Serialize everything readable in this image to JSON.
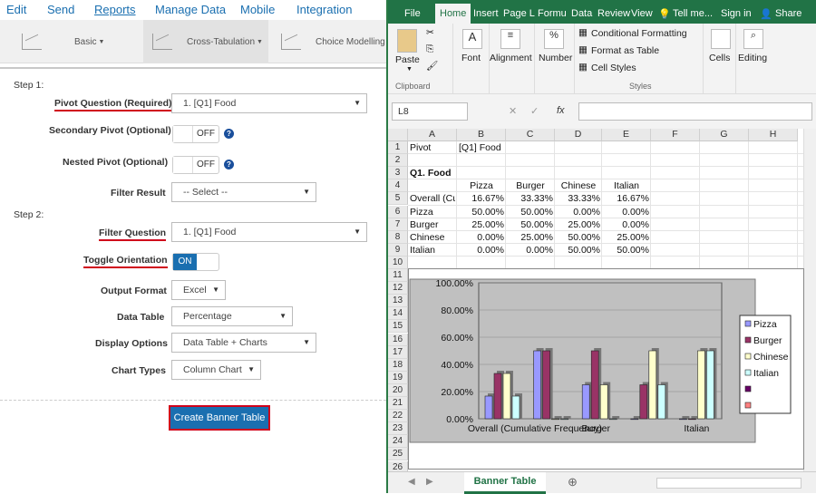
{
  "left": {
    "nav": [
      "Edit",
      "Send",
      "Reports",
      "Manage Data",
      "Mobile",
      "Integration"
    ],
    "active_nav": "Reports",
    "toolbar": [
      "Basic",
      "Cross-Tabulation",
      "Choice Modelling"
    ],
    "step1": "Step 1:",
    "step2": "Step 2:",
    "fields": {
      "pivot_question": {
        "label": "Pivot Question (Required)",
        "value": "1. [Q1] Food"
      },
      "secondary_pivot": {
        "label": "Secondary Pivot (Optional)",
        "value": "OFF"
      },
      "nested_pivot": {
        "label": "Nested Pivot (Optional)",
        "value": "OFF"
      },
      "filter_result": {
        "label": "Filter Result",
        "value": "-- Select --"
      },
      "filter_question": {
        "label": "Filter Question",
        "value": "1. [Q1] Food"
      },
      "toggle_orientation": {
        "label": "Toggle Orientation",
        "value": "ON"
      },
      "output_format": {
        "label": "Output Format",
        "value": "Excel"
      },
      "data_table": {
        "label": "Data Table",
        "value": "Percentage"
      },
      "display_options": {
        "label": "Display Options",
        "value": "Data Table + Charts"
      },
      "chart_types": {
        "label": "Chart Types",
        "value": "Column Chart"
      }
    },
    "create_button": "Create Banner Table"
  },
  "excel": {
    "tabs": [
      "File",
      "Home",
      "Insert",
      "Page L",
      "Formu",
      "Data",
      "Review",
      "View",
      "Tell me...",
      "Sign in",
      "Share"
    ],
    "ribbon": {
      "paste": "Paste",
      "clipboard": "Clipboard",
      "font": "Font",
      "alignment": "Alignment",
      "number": "Number",
      "conditional": "Conditional Formatting",
      "format_table": "Format as Table",
      "cell_styles": "Cell Styles",
      "styles": "Styles",
      "cells": "Cells",
      "editing": "Editing"
    },
    "name_box": "L8",
    "fx": "fx",
    "columns": [
      "A",
      "B",
      "C",
      "D",
      "E",
      "F",
      "G",
      "H"
    ],
    "rows": [
      "1",
      "2",
      "3",
      "4",
      "5",
      "6",
      "7",
      "8",
      "9",
      "10",
      "11",
      "12",
      "13",
      "14",
      "15",
      "16",
      "17",
      "18",
      "19",
      "20",
      "21",
      "22",
      "23",
      "24",
      "25",
      "26",
      "27"
    ],
    "cells": {
      "a1": "Pivot",
      "b1": "[Q1] Food",
      "a3": "Q1. Food",
      "b4": "Pizza",
      "c4": "Burger",
      "d4": "Chinese",
      "e4": "Italian",
      "a5": "Overall (Cu",
      "b5": "16.67%",
      "c5": "33.33%",
      "d5": "33.33%",
      "e5": "16.67%",
      "a6": "Pizza",
      "b6": "50.00%",
      "c6": "50.00%",
      "d6": "0.00%",
      "e6": "0.00%",
      "a7": "Burger",
      "b7": "25.00%",
      "c7": "50.00%",
      "d7": "25.00%",
      "e7": "0.00%",
      "a8": "Chinese",
      "b8": "0.00%",
      "c8": "25.00%",
      "d8": "50.00%",
      "e8": "25.00%",
      "a9": "Italian",
      "b9": "0.00%",
      "c9": "0.00%",
      "d9": "50.00%",
      "e9": "50.00%"
    },
    "sheet_tab": "Banner Table"
  },
  "chart_data": {
    "type": "bar",
    "categories": [
      "Overall (Cumulative Frequency)",
      "Pizza",
      "Burger",
      "Chinese",
      "Italian"
    ],
    "x_tick_labels": [
      "Overall (Cumulative Frequency)",
      "Burger",
      "Italian"
    ],
    "series": [
      {
        "name": "Pizza",
        "color": "#9999ff",
        "values": [
          16.67,
          50,
          25,
          0,
          0
        ]
      },
      {
        "name": "Burger",
        "color": "#993366",
        "values": [
          33.33,
          50,
          50,
          25,
          0
        ]
      },
      {
        "name": "Chinese",
        "color": "#ffffcc",
        "values": [
          33.33,
          0,
          25,
          50,
          50
        ]
      },
      {
        "name": "Italian",
        "color": "#ccffff",
        "values": [
          16.67,
          0,
          0,
          25,
          50
        ]
      }
    ],
    "legend_extra": [
      {
        "color": "#660066"
      },
      {
        "color": "#ff8080"
      }
    ],
    "yticks": [
      "100.00%",
      "80.00%",
      "60.00%",
      "40.00%",
      "20.00%",
      "0.00%"
    ],
    "ylim": [
      0,
      100
    ]
  }
}
